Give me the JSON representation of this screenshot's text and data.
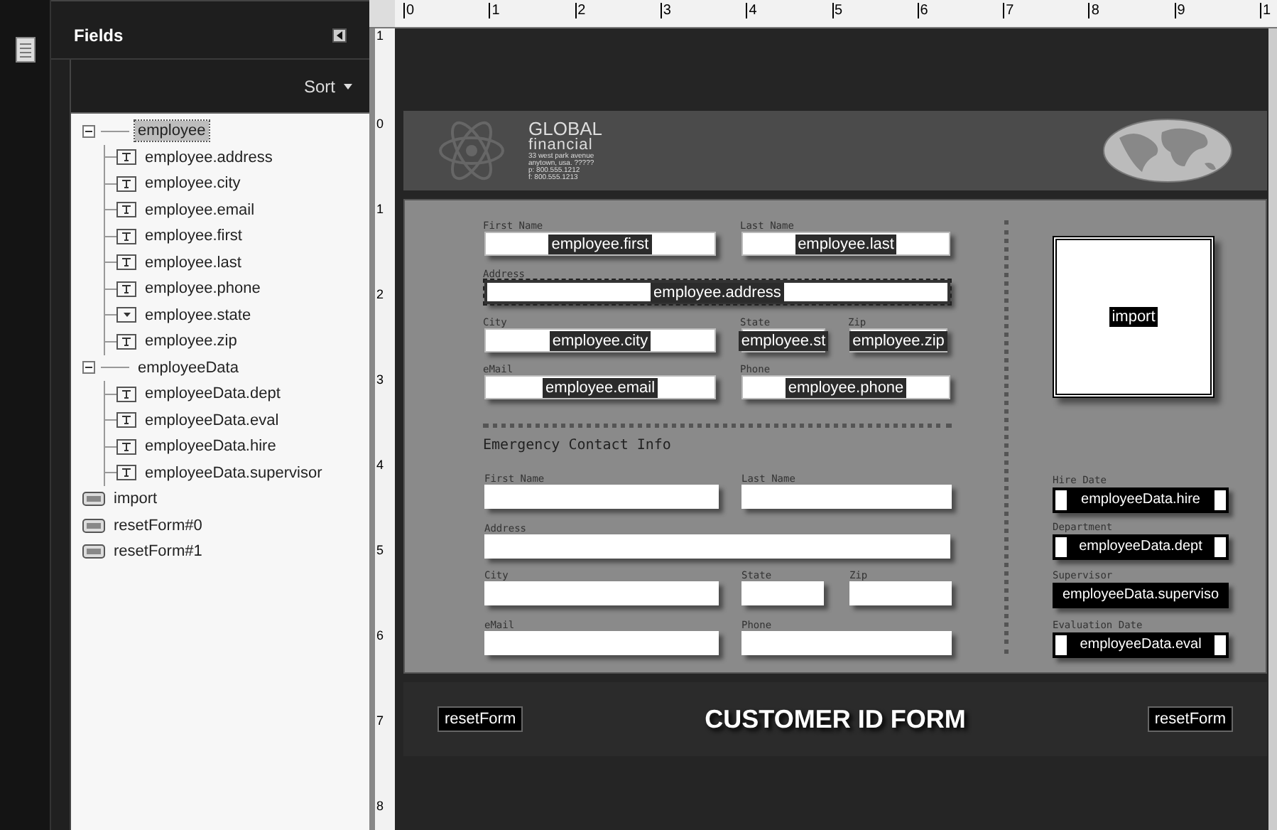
{
  "sidebar": {
    "title": "Fields",
    "sort_label": "Sort",
    "tree": [
      {
        "label": "employee",
        "kind": "group",
        "selected": true,
        "expanded": true,
        "children": [
          {
            "label": "employee.address",
            "kind": "text",
            "selected": false
          },
          {
            "label": "employee.city",
            "kind": "text",
            "selected": false
          },
          {
            "label": "employee.email",
            "kind": "text",
            "selected": false
          },
          {
            "label": "employee.first",
            "kind": "text",
            "selected": false
          },
          {
            "label": "employee.last",
            "kind": "text",
            "selected": false
          },
          {
            "label": "employee.phone",
            "kind": "text",
            "selected": false
          },
          {
            "label": "employee.state",
            "kind": "dropdown",
            "selected": false
          },
          {
            "label": "employee.zip",
            "kind": "text",
            "selected": false
          }
        ]
      },
      {
        "label": "employeeData",
        "kind": "group",
        "selected": false,
        "expanded": true,
        "children": [
          {
            "label": "employeeData.dept",
            "kind": "text",
            "selected": false
          },
          {
            "label": "employeeData.eval",
            "kind": "text",
            "selected": false
          },
          {
            "label": "employeeData.hire",
            "kind": "text",
            "selected": false
          },
          {
            "label": "employeeData.supervisor",
            "kind": "text",
            "selected": false
          }
        ]
      },
      {
        "label": "import",
        "kind": "button",
        "selected": false
      },
      {
        "label": "resetForm#0",
        "kind": "button",
        "selected": false
      },
      {
        "label": "resetForm#1",
        "kind": "button",
        "selected": false
      }
    ]
  },
  "ruler": {
    "horizontal": [
      "0",
      "1",
      "2",
      "3",
      "4",
      "5",
      "6",
      "7",
      "8",
      "9",
      "1"
    ],
    "vertical": [
      "1",
      "0",
      "1",
      "2",
      "3",
      "4",
      "5",
      "6",
      "7",
      "8"
    ]
  },
  "form": {
    "logo": {
      "name": "GLOBAL",
      "sub": "financial",
      "lines": [
        "33 west park avenue",
        "anytown, usa. ?????",
        "p: 800.555.1212",
        "f: 800.555.1213"
      ]
    },
    "employee_fields": [
      {
        "label": "First Name",
        "binding": "employee.first",
        "selected": false
      },
      {
        "label": "Last Name",
        "binding": "employee.last",
        "selected": false
      },
      {
        "label": "Address",
        "binding": "employee.address",
        "selected": true
      },
      {
        "label": "City",
        "binding": "employee.city",
        "selected": false
      },
      {
        "label": "State",
        "binding": "employee.st",
        "selected": false
      },
      {
        "label": "Zip",
        "binding": "employee.zip",
        "selected": false
      },
      {
        "label": "eMail",
        "binding": "employee.email",
        "selected": false
      },
      {
        "label": "Phone",
        "binding": "employee.phone",
        "selected": false
      }
    ],
    "emergency_title": "Emergency Contact Info",
    "emergency_fields": [
      {
        "label": "First Name"
      },
      {
        "label": "Last Name"
      },
      {
        "label": "Address"
      },
      {
        "label": "City"
      },
      {
        "label": "State"
      },
      {
        "label": "Zip"
      },
      {
        "label": "eMail"
      },
      {
        "label": "Phone"
      }
    ],
    "import_button": "import",
    "data_fields": [
      {
        "label": "Hire Date",
        "binding": "employeeData.hire",
        "kind": "padded"
      },
      {
        "label": "Department",
        "binding": "employeeData.dept",
        "kind": "padded"
      },
      {
        "label": "Supervisor",
        "binding": "employeeData.superviso",
        "kind": "plain"
      },
      {
        "label": "Evaluation Date",
        "binding": "employeeData.eval",
        "kind": "padded"
      }
    ],
    "footer_title": "CUSTOMER ID FORM",
    "footer_buttons": [
      "resetForm",
      "resetForm"
    ]
  }
}
